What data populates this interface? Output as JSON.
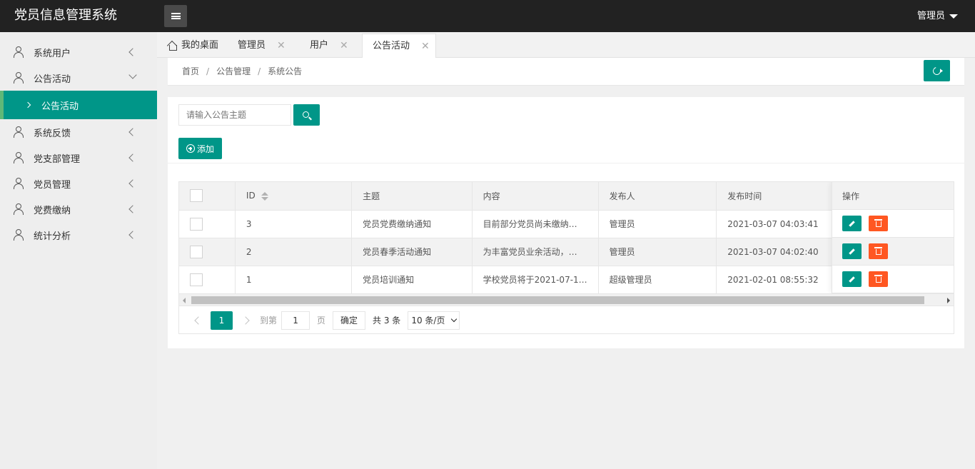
{
  "app": {
    "title": "党员信息管理系统",
    "user": "管理员"
  },
  "sidebar": {
    "items": [
      {
        "label": "系统用户"
      },
      {
        "label": "公告活动",
        "sub": "公告活动"
      },
      {
        "label": "系统反馈"
      },
      {
        "label": "党支部管理"
      },
      {
        "label": "党员管理"
      },
      {
        "label": "党费缴纳"
      },
      {
        "label": "统计分析"
      }
    ]
  },
  "tabs": [
    {
      "label": "我的桌面"
    },
    {
      "label": "管理员"
    },
    {
      "label": "用户"
    },
    {
      "label": "公告活动"
    }
  ],
  "breadcrumb": {
    "home": "首页",
    "level1": "公告管理",
    "level2": "系统公告"
  },
  "search": {
    "placeholder": "请输入公告主题"
  },
  "toolbar": {
    "add_label": "添加"
  },
  "table": {
    "columns": [
      "ID",
      "主题",
      "内容",
      "发布人",
      "发布时间",
      "操作"
    ],
    "rows": [
      {
        "id": "3",
        "title": "党员党费缴纳通知",
        "content": "目前部分党员尚未缴纳…",
        "publisher": "管理员",
        "time": "2021-03-07 04:03:41"
      },
      {
        "id": "2",
        "title": "党员春季活动通知",
        "content": "为丰富党员业余活动，…",
        "publisher": "管理员",
        "time": "2021-03-07 04:02:40"
      },
      {
        "id": "1",
        "title": "党员培训通知",
        "content": "学校党员将于2021-07-1…",
        "publisher": "超级管理员",
        "time": "2021-02-01 08:55:32"
      }
    ]
  },
  "pager": {
    "current": "1",
    "goto_label": "到第",
    "page_value": "1",
    "page_unit": "页",
    "confirm": "确定",
    "total": "共 3 条",
    "page_size": "10 条/页"
  },
  "colors": {
    "primary": "#009688",
    "danger": "#ff5722",
    "header_bg": "#222222"
  }
}
